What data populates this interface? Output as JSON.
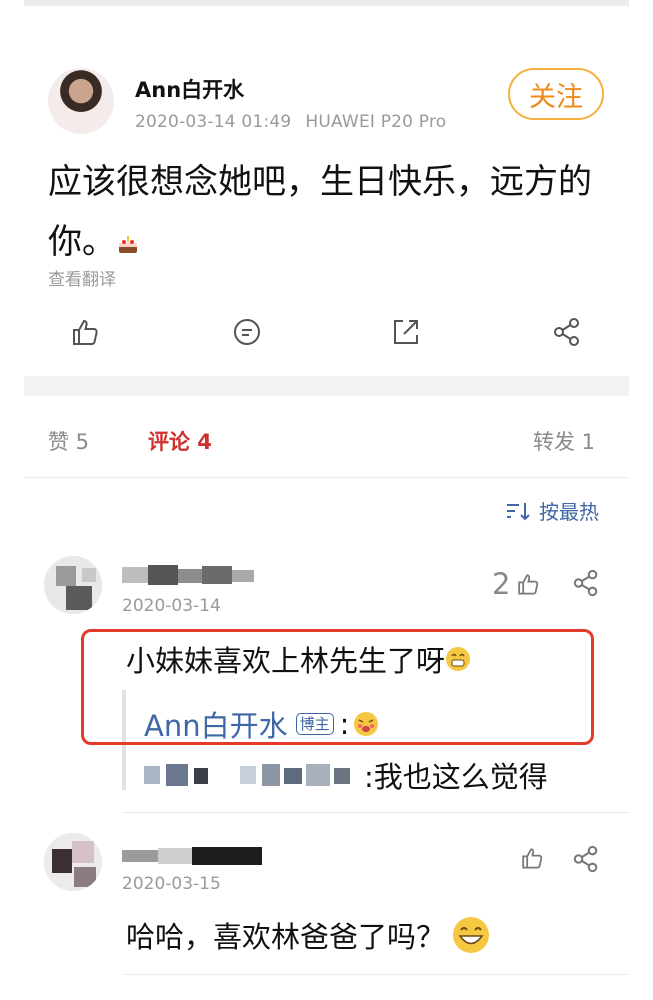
{
  "post": {
    "author": "Ann白开水",
    "timestamp": "2020-03-14 01:49",
    "device": "HUAWEI P20 Pro",
    "follow_label": "关注",
    "text": "应该很想念她吧，生日快乐，远方的你。",
    "translate_label": "查看翻译"
  },
  "stats": {
    "likes_label": "赞 5",
    "comments_label": "评论 4",
    "reposts_label": "转发 1"
  },
  "sort_label": "按最热",
  "comments": [
    {
      "date": "2020-03-14",
      "likes": "2",
      "text": "小妹妹喜欢上林先生了呀",
      "reply_author": "Ann白开水",
      "reply_badge": "博主",
      "reply2_text": ":我也这么觉得"
    },
    {
      "date": "2020-03-15",
      "text": "哈哈，喜欢林爸爸了吗？"
    }
  ],
  "colors": {
    "accent_orange": "#f08a1b",
    "comment_red": "#d0312d",
    "link_blue": "#3f67a6",
    "highlight_red": "#e43a2a"
  }
}
